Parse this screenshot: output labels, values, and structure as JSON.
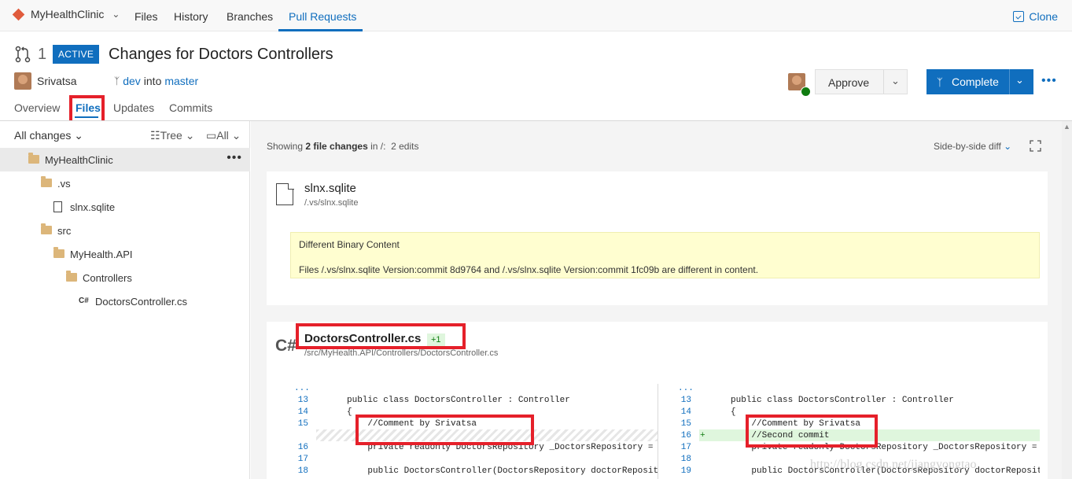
{
  "topnav": {
    "project": "MyHealthClinic",
    "items": [
      "Files",
      "History",
      "Branches",
      "Pull Requests"
    ],
    "active": "Pull Requests",
    "clone": "Clone"
  },
  "pr": {
    "number": "1",
    "status": "ACTIVE",
    "title": "Changes for Doctors Controllers",
    "author": "Srivatsa",
    "source_branch": "dev",
    "into": "into",
    "target_branch": "master",
    "tabs": [
      "Overview",
      "Files",
      "Updates",
      "Commits"
    ],
    "active_tab": "Files",
    "approve": "Approve",
    "complete": "Complete"
  },
  "tree": {
    "filter": "All changes",
    "view": "Tree",
    "scope": "All",
    "root": "MyHealthClinic",
    "nodes": [
      ".vs",
      "slnx.sqlite",
      "src",
      "MyHealth.API",
      "Controllers",
      "DoctorsController.cs"
    ],
    "cs_glyph": "C#"
  },
  "summary": {
    "prefix": "Showing",
    "count": "2 file changes",
    "suffix": "in /:",
    "edits": "2 edits",
    "diff_mode": "Side-by-side diff"
  },
  "file1": {
    "name": "slnx.sqlite",
    "path": "/.vs/slnx.sqlite",
    "notice_title": "Different Binary Content",
    "notice_body": "Files /.vs/slnx.sqlite Version:commit 8d9764 and /.vs/slnx.sqlite Version:commit 1fc09b are different in content."
  },
  "file2": {
    "name": "DoctorsController.cs",
    "delta": "+1",
    "path": "/src/MyHealth.API/Controllers/DoctorsController.cs",
    "lang_glyph": "C#"
  },
  "diff": {
    "ellipsis": "...",
    "left": [
      {
        "n": "13",
        "code": "public class DoctorsController : Controller"
      },
      {
        "n": "14",
        "code": "{"
      },
      {
        "n": "15",
        "code": "    //Comment by Srivatsa"
      },
      {
        "n": "16",
        "code": "    private readonly DoctorsRepository _DoctorsRepository ="
      },
      {
        "n": "17",
        "code": ""
      },
      {
        "n": "18",
        "code": "    public DoctorsController(DoctorsRepository doctorReposit"
      }
    ],
    "right": [
      {
        "n": "13",
        "code": "public class DoctorsController : Controller"
      },
      {
        "n": "14",
        "code": "{"
      },
      {
        "n": "15",
        "code": "    //Comment by Srivatsa"
      },
      {
        "n": "16",
        "code": "    //Second commit"
      },
      {
        "n": "17",
        "code": "    private readonly DoctorsRepository _DoctorsRepository ="
      },
      {
        "n": "18",
        "code": ""
      },
      {
        "n": "19",
        "code": "    public DoctorsController(DoctorsRepository doctorReposit"
      }
    ],
    "plus": "+"
  },
  "watermark": "http://blog.csdn.net/jiangyongtao"
}
